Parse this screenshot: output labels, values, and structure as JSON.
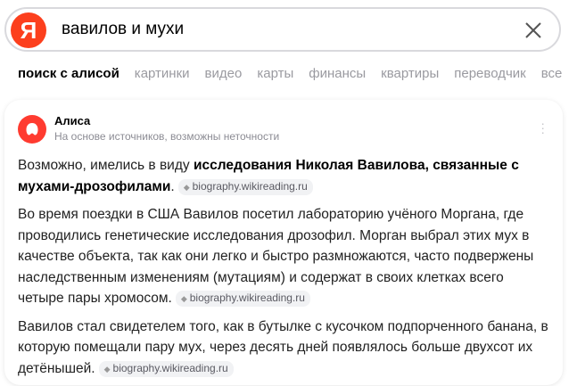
{
  "search": {
    "logo_letter": "Я",
    "query": "вавилов и мухи"
  },
  "tabs": [
    {
      "label": "поиск с алисой",
      "active": true
    },
    {
      "label": "картинки"
    },
    {
      "label": "видео"
    },
    {
      "label": "карты"
    },
    {
      "label": "финансы"
    },
    {
      "label": "квартиры"
    },
    {
      "label": "переводчик"
    },
    {
      "label": "все"
    }
  ],
  "alice": {
    "name": "Алиса",
    "subtitle": "На основе источников, возможны неточности"
  },
  "answer": {
    "p1_pre": "Возможно, имелись в виду ",
    "p1_bold": "исследования Николая Вавилова, связанные с мухами-дрозофилами",
    "p1_post": ".",
    "p2": "Во время поездки в США Вавилов посетил лабораторию учёного Моргана, где проводились генетические исследования дрозофил. Морган выбрал этих мух в качестве объекта, так как они легко и быстро размножаются, часто подвержены наследственным изменениям (мутациям) и содержат в своих клетках всего четыре пары хромосом.",
    "p3": "Вавилов стал свидетелем того, как в бутылке с кусочком подпорченного банана, в которую помещали пару мух, через десять дней появлялось больше двухсот их детёнышей.",
    "source": "biography.wikireading.ru"
  },
  "colors": {
    "yandex_red": "#fc3f1d",
    "alice_red": "#ff3b30"
  }
}
